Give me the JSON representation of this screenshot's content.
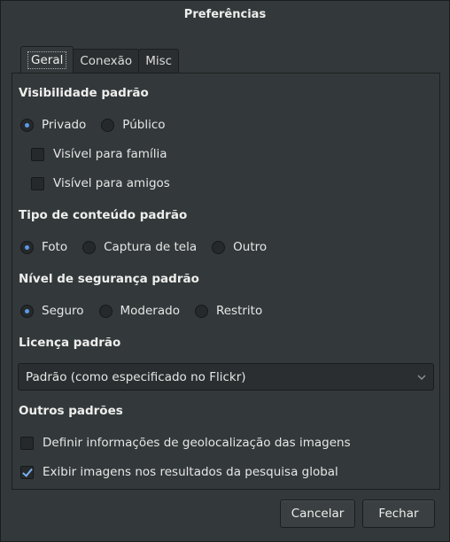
{
  "window": {
    "title": "Preferências"
  },
  "tabs": [
    {
      "label": "Geral",
      "active": true
    },
    {
      "label": "Conexão",
      "active": false
    },
    {
      "label": "Misc",
      "active": false
    }
  ],
  "visibility": {
    "title": "Visibilidade padrão",
    "options": [
      {
        "label": "Privado",
        "checked": true
      },
      {
        "label": "Público",
        "checked": false
      }
    ],
    "family": {
      "label": "Visível para família",
      "checked": false
    },
    "friends": {
      "label": "Visível para amigos",
      "checked": false
    }
  },
  "content_type": {
    "title": "Tipo de conteúdo padrão",
    "options": [
      {
        "label": "Foto",
        "checked": true
      },
      {
        "label": "Captura de tela",
        "checked": false
      },
      {
        "label": "Outro",
        "checked": false
      }
    ]
  },
  "safety": {
    "title": "Nível de segurança padrão",
    "options": [
      {
        "label": "Seguro",
        "checked": true
      },
      {
        "label": "Moderado",
        "checked": false
      },
      {
        "label": "Restrito",
        "checked": false
      }
    ]
  },
  "license": {
    "title": "Licença padrão",
    "selected": "Padrão (como especificado no Flickr)"
  },
  "other": {
    "title": "Outros padrões",
    "geo": {
      "label": "Definir informações de geolocalização das imagens",
      "checked": false
    },
    "search": {
      "label": "Exibir imagens nos resultados da pesquisa global",
      "checked": true
    }
  },
  "buttons": {
    "cancel": "Cancelar",
    "close": "Fechar"
  },
  "colors": {
    "accent": "#5a9ae4",
    "background": "#33393b",
    "input": "#26292b"
  }
}
